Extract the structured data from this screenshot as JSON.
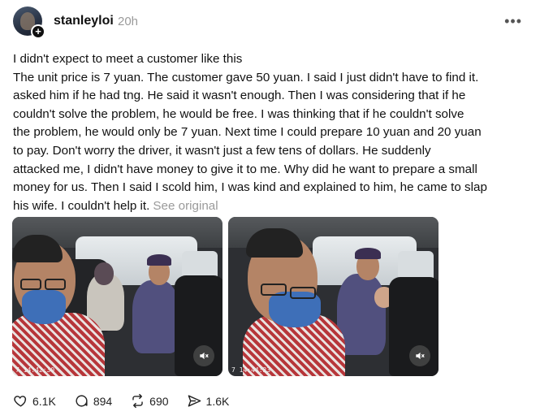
{
  "post": {
    "username": "stanleyloi",
    "timestamp": "20h",
    "more_icon": "ellipsis-icon",
    "lines": [
      "I didn't expect to meet a customer like this",
      "The unit price is 7 yuan. The customer gave 50 yuan. I said I just didn't have to find it.",
      "asked him if he had tng. He said it wasn't enough. Then I was considering that if he",
      "couldn't solve the problem, he would be free. I was thinking that if he couldn't solve",
      "the problem, he would only be 7 yuan. Next time I could prepare 10 yuan and 20 yuan",
      "to pay. Don't worry the driver, it wasn't just a few tens of dollars. He suddenly",
      "attacked me, I didn't have money to give it to me. Why did he want to prepare a small",
      "money for us. Then I said I scold him, I was kind and explained to him, he came to slap",
      "his wife. I couldn't help it."
    ],
    "see_original": "See original"
  },
  "media": [
    {
      "timestamp": "7 14:42:30",
      "icon": "mute-icon"
    },
    {
      "timestamp": "7 14:44:23",
      "icon": "mute-icon"
    }
  ],
  "actions": {
    "likes": "6.1K",
    "comments": "894",
    "reposts": "690",
    "shares": "1.6K"
  }
}
